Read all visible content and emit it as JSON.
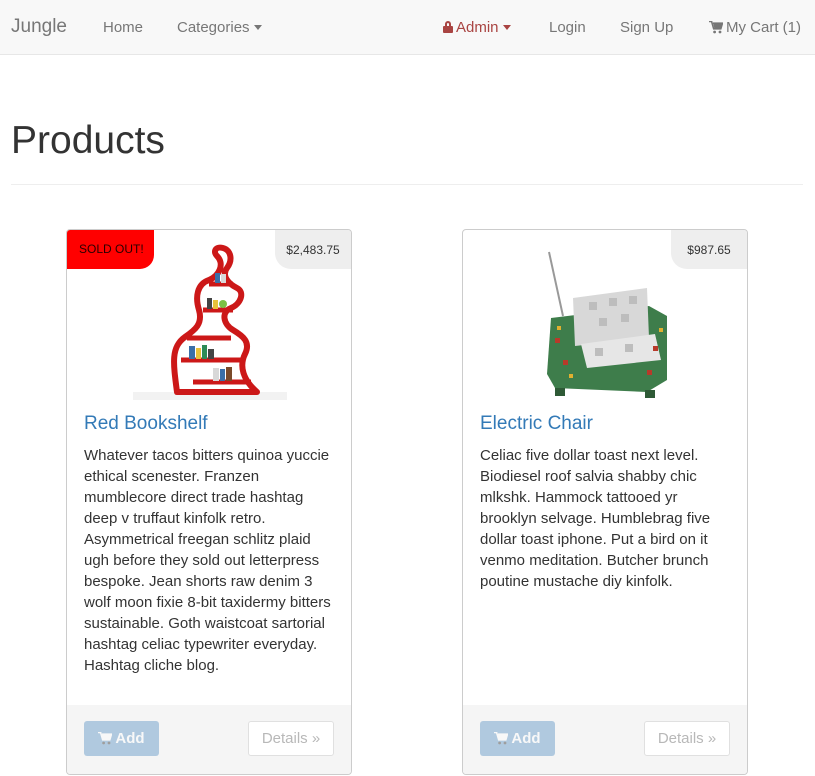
{
  "navbar": {
    "brand": "Jungle",
    "home": "Home",
    "categories": "Categories",
    "admin": "Admin",
    "login": "Login",
    "signup": "Sign Up",
    "cart": "My Cart (1)"
  },
  "page": {
    "title": "Products"
  },
  "products": [
    {
      "sold_out": "SOLD OUT!",
      "price": "$2,483.75",
      "name": "Red Bookshelf",
      "description": "Whatever tacos bitters quinoa yuccie ethical scenester. Franzen mumblecore direct trade hashtag deep v truffaut kinfolk retro. Asymmetrical freegan schlitz plaid ugh before they sold out letterpress bespoke. Jean shorts raw denim 3 wolf moon fixie 8-bit taxidermy bitters sustainable. Goth waistcoat sartorial hashtag celiac typewriter everyday. Hashtag cliche blog.",
      "add_label": "Add",
      "details_label": "Details »",
      "image_icon": "red-bookshelf-image"
    },
    {
      "price": "$987.65",
      "name": "Electric Chair",
      "description": "Celiac five dollar toast next level. Biodiesel roof salvia shabby chic mlkshk. Hammock tattooed yr brooklyn selvage. Humblebrag five dollar toast iphone. Put a bird on it venmo meditation. Butcher brunch poutine mustache diy kinfolk.",
      "add_label": "Add",
      "details_label": "Details »",
      "image_icon": "electric-chair-image"
    }
  ],
  "colors": {
    "navbar_bg": "#f8f8f8",
    "admin_red": "#a94442",
    "link_blue": "#337ab7",
    "sold_out_red": "#ff0000"
  }
}
